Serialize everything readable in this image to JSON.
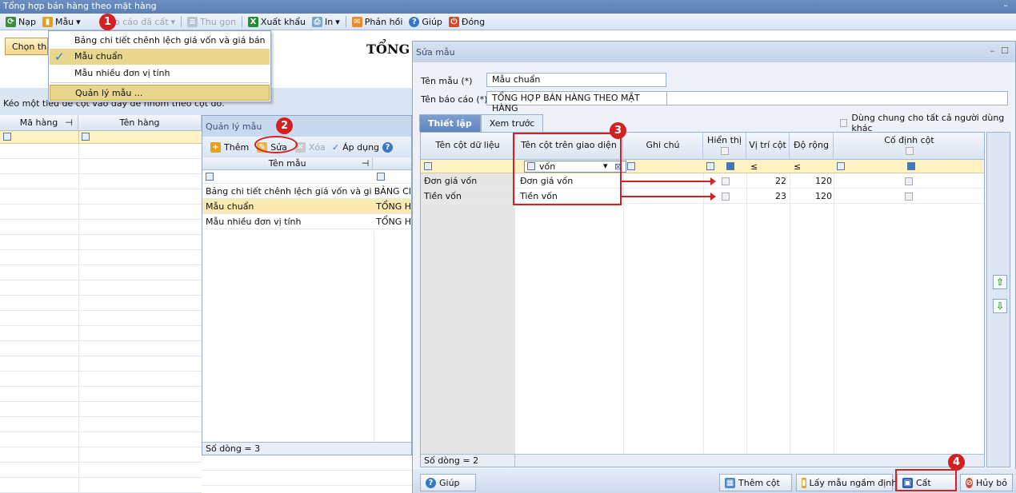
{
  "window": {
    "title": "Tổng hợp bán hàng theo mặt hàng"
  },
  "toolbar": {
    "reload": "Nạp",
    "template": "Mẫu",
    "saved_reports": "Báo cáo đã cất",
    "collapse": "Thu gọn",
    "export": "Xuất khẩu",
    "print": "In",
    "feedback": "Phản hồi",
    "help": "Giúp",
    "close": "Đóng"
  },
  "template_menu": {
    "items": [
      {
        "label": "Bảng chi tiết chênh lệch giá vốn và giá bán"
      },
      {
        "label": "Mẫu chuẩn"
      },
      {
        "label": "Mẫu nhiều đơn vị tính"
      },
      {
        "label": "Quản lý mẫu ..."
      }
    ]
  },
  "report": {
    "choose_button": "Chọn tham số",
    "title_partial": "TỔNG",
    "group_hint": "Kéo một tiêu đề cột vào đây để nhóm theo cột đó.",
    "columns": [
      "Mã hàng",
      "Tên hàng"
    ]
  },
  "template_manager": {
    "title": "Quản lý mẫu",
    "add": "Thêm",
    "edit": "Sửa",
    "delete": "Xóa",
    "apply": "Áp dụng",
    "column": "Tên mẫu",
    "rows": [
      {
        "name": "Bảng chi tiết chênh lệch giá vốn và giá bán",
        "report": "BẢNG CI"
      },
      {
        "name": "Mẫu chuẩn",
        "report": "TỔNG H"
      },
      {
        "name": "Mẫu nhiều đơn vị tính",
        "report": "TỔNG H"
      }
    ],
    "row_count": "Số dòng = 3"
  },
  "edit_dialog": {
    "title": "Sửa mẫu",
    "template_name_label": "Tên mẫu (*)",
    "template_name_value": "Mẫu chuẩn",
    "report_name_label": "Tên báo cáo (*)",
    "report_name_value": "TỔNG HỢP BÁN HÀNG THEO MẶT HÀNG",
    "share_label": "Dùng chung cho tất cả người dùng khác",
    "tabs": [
      "Thiết lập",
      "Xem trước"
    ],
    "columns": [
      "Tên cột dữ liệu",
      "Tên cột trên giao diện",
      "Ghi chú",
      "Hiển thị",
      "Vị trí cột",
      "Độ rộng",
      "Cố định cột"
    ],
    "filter_value": "vốn",
    "filter_ops": [
      "≤",
      "≤"
    ],
    "rows": [
      {
        "data_col": "Đơn giá vốn",
        "ui_col": "Đơn giá vốn",
        "position": "22",
        "width": "120"
      },
      {
        "data_col": "Tiền vốn",
        "ui_col": "Tiền vốn",
        "position": "23",
        "width": "120"
      }
    ],
    "row_count": "Số dòng = 2",
    "buttons": {
      "help": "Giúp",
      "add_column": "Thêm cột",
      "load_default": "Lấy mẫu ngầm định",
      "save": "Cất",
      "cancel": "Hủy bỏ"
    }
  },
  "callouts": [
    "1",
    "2",
    "3",
    "4"
  ],
  "colors": {
    "accent": "#d32020",
    "highlight": "#e8d68e",
    "filter_row": "#fff3c4"
  }
}
